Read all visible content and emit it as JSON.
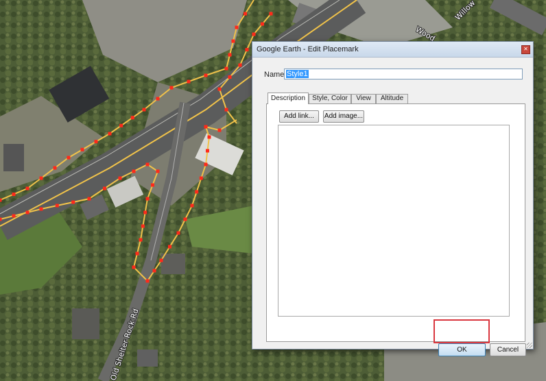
{
  "window": {
    "title": "Google Earth - Edit Placemark",
    "close_glyph": "✕"
  },
  "name_field": {
    "label": "Name:",
    "value": "Style1"
  },
  "tabs": [
    {
      "label": "Description",
      "active": true
    },
    {
      "label": "Style, Color",
      "active": false
    },
    {
      "label": "View",
      "active": false
    },
    {
      "label": "Altitude",
      "active": false
    }
  ],
  "description": {
    "add_link_label": "Add link...",
    "add_image_label": "Add image...",
    "text": ""
  },
  "buttons": {
    "ok_label": "OK",
    "cancel_label": "Cancel"
  },
  "map": {
    "road_labels": [
      "Old Shelter Rock Rd",
      "Willow",
      "Wood"
    ],
    "route_color": "#f0c24a",
    "marker_color": "#ff2a1a",
    "highlight_color": "#d9363e"
  },
  "icons": {
    "close": "close-icon",
    "resize": "resize-grip-icon"
  }
}
